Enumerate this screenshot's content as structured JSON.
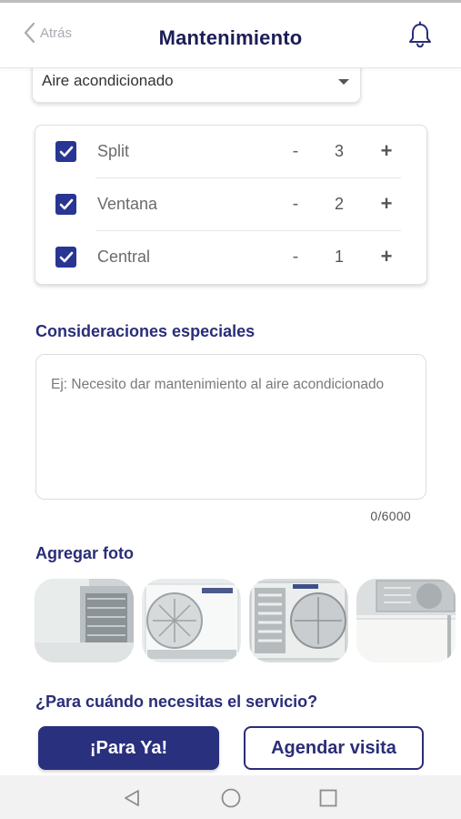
{
  "header": {
    "back_label": "Atrás",
    "title": "Mantenimiento"
  },
  "service_select": {
    "value": "Aire acondicionado"
  },
  "units": [
    {
      "label": "Split",
      "quantity": "3",
      "checked": true
    },
    {
      "label": "Ventana",
      "quantity": "2",
      "checked": true
    },
    {
      "label": "Central",
      "quantity": "1",
      "checked": true
    }
  ],
  "stepper": {
    "minus": "-",
    "plus": "+"
  },
  "considerations": {
    "title": "Consideraciones especiales",
    "placeholder": "Ej: Necesito dar mantenimiento al aire acondicionado",
    "counter": "0/6000"
  },
  "photos": {
    "title": "Agregar foto",
    "items": [
      "photo-1",
      "photo-2",
      "photo-3",
      "photo-4"
    ]
  },
  "schedule": {
    "question": "¿Para cuándo necesitas el servicio?",
    "now_label": "¡Para Ya!",
    "schedule_label": "Agendar visita"
  },
  "colors": {
    "primary": "#29307d",
    "title": "#1c1d57",
    "checkbox": "#283593"
  },
  "system_nav": [
    "back-nav-icon",
    "home-nav-icon",
    "recents-nav-icon"
  ]
}
